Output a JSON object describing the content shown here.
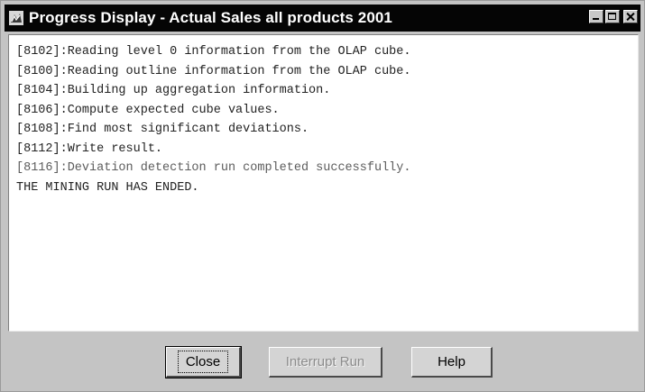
{
  "window": {
    "title": "Progress Display - Actual Sales all products 2001"
  },
  "log": {
    "lines": [
      {
        "text": "[8102]:Reading level 0 information from the OLAP cube."
      },
      {
        "text": "[8100]:Reading outline information from the OLAP cube."
      },
      {
        "text": "[8104]:Building up aggregation information."
      },
      {
        "text": "[8106]:Compute expected cube values."
      },
      {
        "text": "[8108]:Find most significant deviations."
      },
      {
        "text": "[8112]:Write result."
      },
      {
        "text": "[8116]:Deviation detection run completed successfully."
      },
      {
        "text": "THE MINING RUN HAS ENDED."
      }
    ]
  },
  "buttons": {
    "close_label": "Close",
    "interrupt_label": "Interrupt Run",
    "help_label": "Help"
  },
  "icons": {
    "app": "app-icon",
    "minimize": "minimize-icon",
    "maximize": "maximize-icon",
    "close": "close-icon"
  },
  "colors": {
    "titlebar": "#050505",
    "window_bg": "#c4c4c4",
    "log_bg": "#ffffff"
  }
}
